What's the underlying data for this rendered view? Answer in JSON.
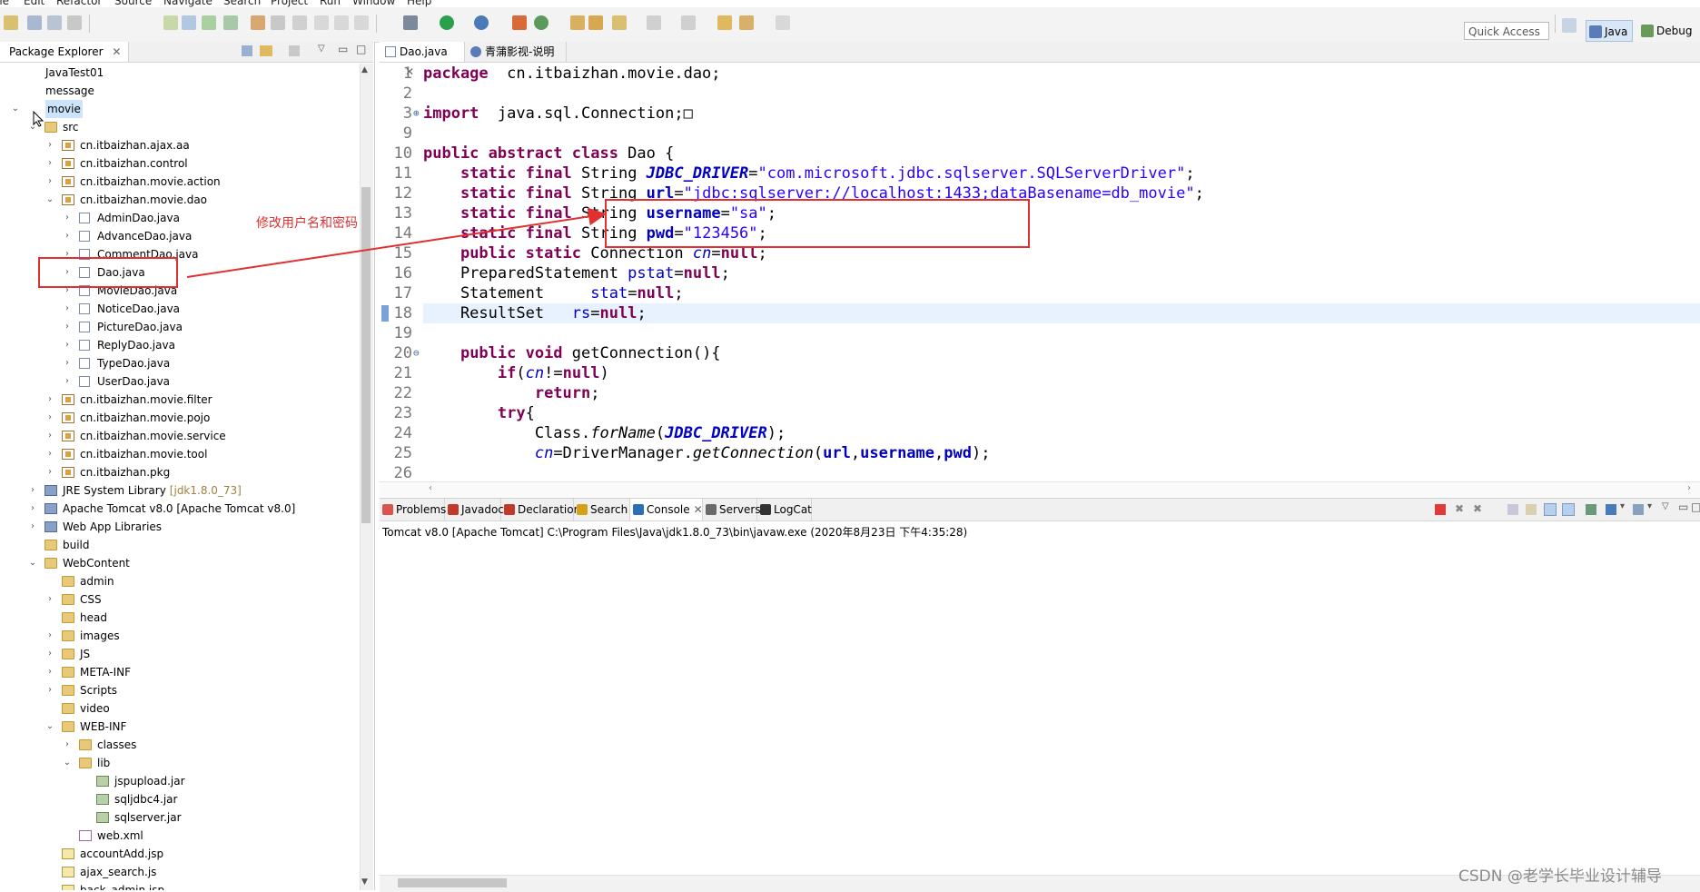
{
  "menu": [
    "ile",
    "Edit",
    "Refactor",
    "Source",
    "Navigate",
    "Search",
    "Project",
    "Run",
    "Window",
    "Help"
  ],
  "toolbar": {
    "quick_access": "Quick Access",
    "perspectives": [
      {
        "label": "Java",
        "icon": "java-perspective-icon",
        "color": "#d8e6f6"
      },
      {
        "label": "Debug",
        "icon": "debug-perspective-icon",
        "color": "#e8e8e8"
      }
    ]
  },
  "package_explorer": {
    "title": "Package Explorer",
    "tree": [
      {
        "label": "JavaTest01",
        "depth": 0,
        "twisty": "",
        "icon": "project"
      },
      {
        "label": "message",
        "depth": 0,
        "twisty": "",
        "icon": "project"
      },
      {
        "label": "movie",
        "depth": 0,
        "twisty": "v",
        "icon": "project",
        "selected": true
      },
      {
        "label": "src",
        "depth": 1,
        "twisty": "v",
        "icon": "folder"
      },
      {
        "label": "cn.itbaizhan.ajax.aa",
        "depth": 2,
        "twisty": ">",
        "icon": "pkg"
      },
      {
        "label": "cn.itbaizhan.control",
        "depth": 2,
        "twisty": ">",
        "icon": "pkg"
      },
      {
        "label": "cn.itbaizhan.movie.action",
        "depth": 2,
        "twisty": ">",
        "icon": "pkg"
      },
      {
        "label": "cn.itbaizhan.movie.dao",
        "depth": 2,
        "twisty": "v",
        "icon": "pkg"
      },
      {
        "label": "AdminDao.java",
        "depth": 3,
        "twisty": ">",
        "icon": "jfile"
      },
      {
        "label": "AdvanceDao.java",
        "depth": 3,
        "twisty": ">",
        "icon": "jfile"
      },
      {
        "label": "CommentDao.java",
        "depth": 3,
        "twisty": ">",
        "icon": "jfile"
      },
      {
        "label": "Dao.java",
        "depth": 3,
        "twisty": ">",
        "icon": "jfile"
      },
      {
        "label": "MovieDao.java",
        "depth": 3,
        "twisty": ">",
        "icon": "jfile"
      },
      {
        "label": "NoticeDao.java",
        "depth": 3,
        "twisty": ">",
        "icon": "jfile"
      },
      {
        "label": "PictureDao.java",
        "depth": 3,
        "twisty": ">",
        "icon": "jfile"
      },
      {
        "label": "ReplyDao.java",
        "depth": 3,
        "twisty": ">",
        "icon": "jfile"
      },
      {
        "label": "TypeDao.java",
        "depth": 3,
        "twisty": ">",
        "icon": "jfile"
      },
      {
        "label": "UserDao.java",
        "depth": 3,
        "twisty": ">",
        "icon": "jfile"
      },
      {
        "label": "cn.itbaizhan.movie.filter",
        "depth": 2,
        "twisty": ">",
        "icon": "pkg"
      },
      {
        "label": "cn.itbaizhan.movie.pojo",
        "depth": 2,
        "twisty": ">",
        "icon": "pkg"
      },
      {
        "label": "cn.itbaizhan.movie.service",
        "depth": 2,
        "twisty": ">",
        "icon": "pkg"
      },
      {
        "label": "cn.itbaizhan.movie.tool",
        "depth": 2,
        "twisty": ">",
        "icon": "pkg"
      },
      {
        "label": "cn.itbaizhan.pkg",
        "depth": 2,
        "twisty": ">",
        "icon": "pkg"
      },
      {
        "label": "JRE System Library",
        "suffix": "[jdk1.8.0_73]",
        "depth": 1,
        "twisty": ">",
        "icon": "lib"
      },
      {
        "label": "Apache Tomcat v8.0 [Apache Tomcat v8.0]",
        "depth": 1,
        "twisty": ">",
        "icon": "lib"
      },
      {
        "label": "Web App Libraries",
        "depth": 1,
        "twisty": ">",
        "icon": "lib"
      },
      {
        "label": "build",
        "depth": 1,
        "twisty": "",
        "icon": "folder"
      },
      {
        "label": "WebContent",
        "depth": 1,
        "twisty": "v",
        "icon": "folder"
      },
      {
        "label": "admin",
        "depth": 2,
        "twisty": "",
        "icon": "folder"
      },
      {
        "label": "CSS",
        "depth": 2,
        "twisty": ">",
        "icon": "folder"
      },
      {
        "label": "head",
        "depth": 2,
        "twisty": "",
        "icon": "folder"
      },
      {
        "label": "images",
        "depth": 2,
        "twisty": ">",
        "icon": "folder"
      },
      {
        "label": "JS",
        "depth": 2,
        "twisty": ">",
        "icon": "folder"
      },
      {
        "label": "META-INF",
        "depth": 2,
        "twisty": ">",
        "icon": "folder"
      },
      {
        "label": "Scripts",
        "depth": 2,
        "twisty": ">",
        "icon": "folder"
      },
      {
        "label": "video",
        "depth": 2,
        "twisty": "",
        "icon": "folder"
      },
      {
        "label": "WEB-INF",
        "depth": 2,
        "twisty": "v",
        "icon": "folder"
      },
      {
        "label": "classes",
        "depth": 3,
        "twisty": ">",
        "icon": "folder"
      },
      {
        "label": "lib",
        "depth": 3,
        "twisty": "v",
        "icon": "folder"
      },
      {
        "label": "jspupload.jar",
        "depth": 4,
        "twisty": "",
        "icon": "jar"
      },
      {
        "label": "sqljdbc4.jar",
        "depth": 4,
        "twisty": "",
        "icon": "jar"
      },
      {
        "label": "sqlserver.jar",
        "depth": 4,
        "twisty": "",
        "icon": "jar"
      },
      {
        "label": "web.xml",
        "depth": 3,
        "twisty": "",
        "icon": "xml"
      },
      {
        "label": "accountAdd.jsp",
        "depth": 2,
        "twisty": "",
        "icon": "js"
      },
      {
        "label": "ajax_search.js",
        "depth": 2,
        "twisty": "",
        "icon": "js"
      },
      {
        "label": "back_admin.jsp",
        "depth": 2,
        "twisty": "",
        "icon": "js"
      }
    ]
  },
  "editor": {
    "tabs": [
      {
        "label": "Dao.java",
        "active": true
      },
      {
        "label": "青蒲影视-说明",
        "active": false
      }
    ],
    "lines": [
      {
        "n": "1",
        "fold": "",
        "tokens": [
          [
            "kw",
            "package"
          ],
          [
            "",
            "  cn.itbaizhan.movie.dao;"
          ]
        ]
      },
      {
        "n": "2",
        "fold": "",
        "tokens": []
      },
      {
        "n": "3",
        "fold": "+",
        "tokens": [
          [
            "kw",
            "import"
          ],
          [
            "",
            "  java.sql.Connection;□"
          ]
        ]
      },
      {
        "n": "9",
        "fold": "",
        "tokens": []
      },
      {
        "n": "10",
        "fold": "",
        "tokens": [
          [
            "kw",
            "public abstract class"
          ],
          [
            "",
            " Dao {"
          ]
        ]
      },
      {
        "n": "11",
        "fold": "",
        "tokens": [
          [
            "",
            "    "
          ],
          [
            "kw",
            "static final"
          ],
          [
            "",
            " String "
          ],
          [
            "sf",
            "JDBC_DRIVER"
          ],
          [
            "",
            "="
          ],
          [
            "st",
            "\"com.microsoft.jdbc.sqlserver.SQLServerDriver\""
          ],
          [
            "",
            ";"
          ]
        ]
      },
      {
        "n": "12",
        "fold": "",
        "tokens": [
          [
            "",
            "    "
          ],
          [
            "kw",
            "static final"
          ],
          [
            "",
            " String "
          ],
          [
            "fb",
            "url"
          ],
          [
            "",
            "="
          ],
          [
            "st",
            "\"jdbc:sqlserver://localhost:1433;dataBasename=db_movie\""
          ],
          [
            "",
            ";"
          ]
        ]
      },
      {
        "n": "13",
        "fold": "",
        "tokens": [
          [
            "",
            "    "
          ],
          [
            "kw",
            "static final"
          ],
          [
            "",
            " String "
          ],
          [
            "fb",
            "username"
          ],
          [
            "",
            "="
          ],
          [
            "st",
            "\"sa\""
          ],
          [
            "",
            ";"
          ]
        ]
      },
      {
        "n": "14",
        "fold": "",
        "tokens": [
          [
            "",
            "    "
          ],
          [
            "kw",
            "static final"
          ],
          [
            "",
            " String "
          ],
          [
            "fb",
            "pwd"
          ],
          [
            "",
            "="
          ],
          [
            "st",
            "\"123456\""
          ],
          [
            "",
            ";"
          ]
        ]
      },
      {
        "n": "15",
        "fold": "",
        "tokens": [
          [
            "",
            "    "
          ],
          [
            "kw",
            "public static"
          ],
          [
            "",
            " Connection "
          ],
          [
            "fd it",
            "cn"
          ],
          [
            "",
            "="
          ],
          [
            "kw",
            "null"
          ],
          [
            "",
            ";"
          ]
        ]
      },
      {
        "n": "16",
        "fold": "",
        "tokens": [
          [
            "",
            "    PreparedStatement "
          ],
          [
            "fd",
            "pstat"
          ],
          [
            "",
            "="
          ],
          [
            "kw",
            "null"
          ],
          [
            "",
            ";"
          ]
        ]
      },
      {
        "n": "17",
        "fold": "",
        "tokens": [
          [
            "",
            "    Statement     "
          ],
          [
            "fd",
            "stat"
          ],
          [
            "",
            "="
          ],
          [
            "kw",
            "null"
          ],
          [
            "",
            ";"
          ]
        ]
      },
      {
        "n": "18",
        "fold": "",
        "tokens": [
          [
            "",
            "    ResultSet   "
          ],
          [
            "fd",
            "rs"
          ],
          [
            "",
            "="
          ],
          [
            "kw",
            "null"
          ],
          [
            "",
            ";"
          ]
        ]
      },
      {
        "n": "19",
        "fold": "",
        "tokens": []
      },
      {
        "n": "20",
        "fold": "-",
        "tokens": [
          [
            "",
            "    "
          ],
          [
            "kw",
            "public void"
          ],
          [
            "",
            " getConnection(){"
          ]
        ]
      },
      {
        "n": "21",
        "fold": "",
        "tokens": [
          [
            "",
            "        "
          ],
          [
            "kw",
            "if"
          ],
          [
            "",
            "("
          ],
          [
            "fd it",
            "cn"
          ],
          [
            "",
            "!="
          ],
          [
            "kw",
            "null"
          ],
          [
            "",
            ")"
          ]
        ]
      },
      {
        "n": "22",
        "fold": "",
        "tokens": [
          [
            "",
            "            "
          ],
          [
            "kw",
            "return"
          ],
          [
            "",
            ";"
          ]
        ]
      },
      {
        "n": "23",
        "fold": "",
        "tokens": [
          [
            "",
            "        "
          ],
          [
            "kw",
            "try"
          ],
          [
            "",
            "{"
          ]
        ]
      },
      {
        "n": "24",
        "fold": "",
        "tokens": [
          [
            "",
            "            Class."
          ],
          [
            "it",
            "forName"
          ],
          [
            "",
            "("
          ],
          [
            "sf",
            "JDBC_DRIVER"
          ],
          [
            "",
            ");"
          ]
        ]
      },
      {
        "n": "25",
        "fold": "",
        "tokens": [
          [
            "",
            "            "
          ],
          [
            "fd it",
            "cn"
          ],
          [
            "",
            "=DriverManager."
          ],
          [
            "it",
            "getConnection"
          ],
          [
            "",
            "("
          ],
          [
            "fb",
            "url"
          ],
          [
            "",
            ","
          ],
          [
            "fb",
            "username"
          ],
          [
            "",
            ","
          ],
          [
            "fb",
            "pwd"
          ],
          [
            "",
            ");"
          ]
        ]
      },
      {
        "n": "26",
        "fold": "",
        "tokens": []
      }
    ]
  },
  "console": {
    "tabs": [
      {
        "label": "Problems",
        "color": "#d9534f"
      },
      {
        "label": "Javadoc",
        "color": "#c0392b"
      },
      {
        "label": "Declaration",
        "color": "#c0392b"
      },
      {
        "label": "Search",
        "color": "#d4a017"
      },
      {
        "label": "Console",
        "color": "#2c6fb5",
        "active": true
      },
      {
        "label": "Servers",
        "color": "#6a6a6a"
      },
      {
        "label": "LogCat",
        "color": "#333333"
      }
    ],
    "line": "Tomcat v8.0  [Apache Tomcat] C:\\Program Files\\Java\\jdk1.8.0_73\\bin\\javaw.exe (2020年8月23日 下午4:35:28)"
  },
  "annotation": {
    "note": "修改用户名和密码",
    "color": "#e03030"
  },
  "watermark": "CSDN @老学长毕业设计辅导"
}
